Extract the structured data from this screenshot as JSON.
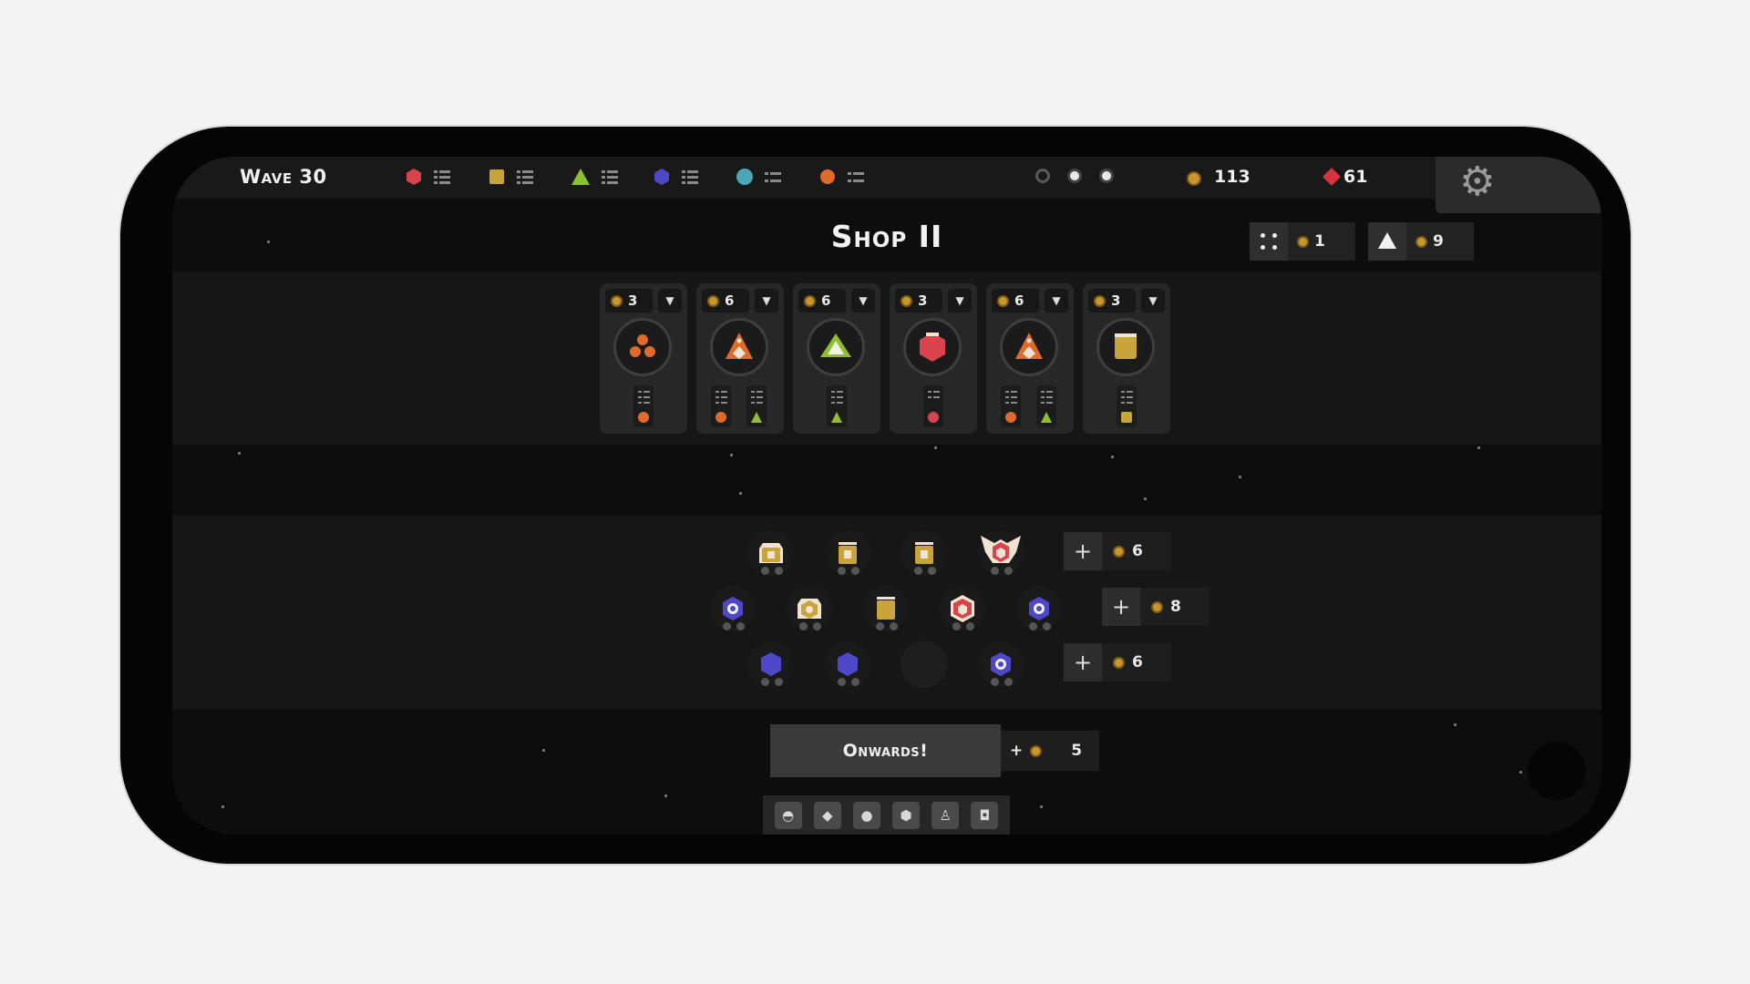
{
  "hud": {
    "wave_label": "Wave 30",
    "resources": [
      {
        "icon": "red-hexagon-icon",
        "color": "#d9434b"
      },
      {
        "icon": "yellow-square-icon",
        "color": "#c9a43a"
      },
      {
        "icon": "green-triangle-icon",
        "color": "#8fbf2e"
      },
      {
        "icon": "blue-hexagon-icon",
        "color": "#4e48c8"
      },
      {
        "icon": "teal-circle-icon",
        "color": "#49a6b2"
      },
      {
        "icon": "orange-circle-icon",
        "color": "#de6a2c"
      }
    ],
    "coins": "113",
    "gems": "61"
  },
  "shop": {
    "title": "Shop II",
    "reroll": {
      "cost": "1"
    },
    "upgrade": {
      "cost": "9"
    },
    "cards": [
      {
        "cost": "3",
        "unit": "orange-cluster"
      },
      {
        "cost": "6",
        "unit": "orange-pyramid"
      },
      {
        "cost": "6",
        "unit": "green-triangle"
      },
      {
        "cost": "3",
        "unit": "red-hexagon"
      },
      {
        "cost": "6",
        "unit": "orange-pyramid"
      },
      {
        "cost": "3",
        "unit": "yellow-square"
      }
    ]
  },
  "formation": {
    "row_costs": [
      "6",
      "8",
      "6"
    ]
  },
  "footer": {
    "onwards_label": "Onwards!",
    "bonus_value": "5",
    "tools": [
      "shield-tool-icon",
      "sword-tool-icon",
      "drop-tool-icon",
      "hex-tool-icon",
      "flask-tool-icon",
      "banner-tool-icon"
    ]
  },
  "colors": {
    "coin": "#c9962c",
    "gem": "#d8343e",
    "red": "#d9434b",
    "yellow": "#c9a43a",
    "green": "#8fbf2e",
    "blue": "#4e48c8",
    "orange": "#de6a2c"
  }
}
